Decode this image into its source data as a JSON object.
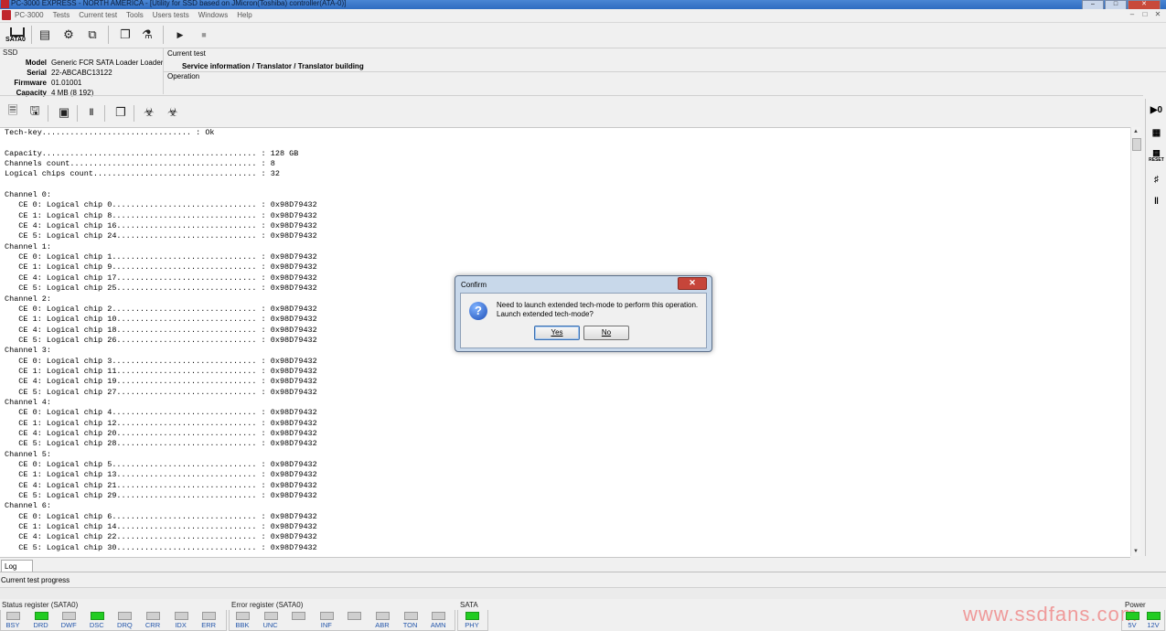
{
  "window": {
    "title": "PC-3000 EXPRESS - NORTH AMERICA - [Utility for SSD based on JMicron(Toshiba) controller(ATA-0)]",
    "controls": [
      "–",
      "□",
      "✕"
    ]
  },
  "menu": {
    "items": [
      "PC-3000",
      "Tests",
      "Current test",
      "Tools",
      "Users tests",
      "Windows",
      "Help"
    ],
    "mdi_controls": [
      "–",
      "□",
      "✕"
    ]
  },
  "toolbar": {
    "sata_label": "SATA0"
  },
  "ssd": {
    "label": "SSD",
    "fields": [
      {
        "key": "Model",
        "value": "Generic FCR SATA Loader Loader"
      },
      {
        "key": "Serial",
        "value": "22-ABCABC13122"
      },
      {
        "key": "Firmware",
        "value": "01.01001"
      },
      {
        "key": "Capacity",
        "value": "4 MB (8 192)"
      }
    ]
  },
  "current_test": {
    "label": "Current test",
    "value": "Service information / Translator / Translator building",
    "operation_label": "Operation"
  },
  "log": {
    "lines": [
      "Tech-key................................ : Ok",
      "",
      "Capacity.............................................. : 128 GB",
      "Channels count........................................ : 8",
      "Logical chips count................................... : 32",
      "",
      "Channel 0:",
      "   CE 0: Logical chip 0............................... : 0x98D79432",
      "   CE 1: Logical chip 8............................... : 0x98D79432",
      "   CE 4: Logical chip 16.............................. : 0x98D79432",
      "   CE 5: Logical chip 24.............................. : 0x98D79432",
      "Channel 1:",
      "   CE 0: Logical chip 1............................... : 0x98D79432",
      "   CE 1: Logical chip 9............................... : 0x98D79432",
      "   CE 4: Logical chip 17.............................. : 0x98D79432",
      "   CE 5: Logical chip 25.............................. : 0x98D79432",
      "Channel 2:",
      "   CE 0: Logical chip 2............................... : 0x98D79432",
      "   CE 1: Logical chip 10.............................. : 0x98D79432",
      "   CE 4: Logical chip 18.............................. : 0x98D79432",
      "   CE 5: Logical chip 26.............................. : 0x98D79432",
      "Channel 3:",
      "   CE 0: Logical chip 3............................... : 0x98D79432",
      "   CE 1: Logical chip 11.............................. : 0x98D79432",
      "   CE 4: Logical chip 19.............................. : 0x98D79432",
      "   CE 5: Logical chip 27.............................. : 0x98D79432",
      "Channel 4:",
      "   CE 0: Logical chip 4............................... : 0x98D79432",
      "   CE 1: Logical chip 12.............................. : 0x98D79432",
      "   CE 4: Logical chip 20.............................. : 0x98D79432",
      "   CE 5: Logical chip 28.............................. : 0x98D79432",
      "Channel 5:",
      "   CE 0: Logical chip 5............................... : 0x98D79432",
      "   CE 1: Logical chip 13.............................. : 0x98D79432",
      "   CE 4: Logical chip 21.............................. : 0x98D79432",
      "   CE 5: Logical chip 29.............................. : 0x98D79432",
      "Channel 6:",
      "   CE 0: Logical chip 6............................... : 0x98D79432",
      "   CE 1: Logical chip 14.............................. : 0x98D79432",
      "   CE 4: Logical chip 22.............................. : 0x98D79432",
      "   CE 5: Logical chip 30.............................. : 0x98D79432"
    ]
  },
  "right_panel": {
    "labels": [
      "RESET"
    ]
  },
  "tabs": {
    "log": "Log"
  },
  "progress": {
    "label": "Current test progress"
  },
  "status_register": {
    "title": "Status register (SATA0)",
    "leds": [
      {
        "name": "BSY",
        "on": false
      },
      {
        "name": "DRD",
        "on": true
      },
      {
        "name": "DWF",
        "on": false
      },
      {
        "name": "DSC",
        "on": true
      },
      {
        "name": "DRQ",
        "on": false
      },
      {
        "name": "CRR",
        "on": false
      },
      {
        "name": "IDX",
        "on": false
      },
      {
        "name": "ERR",
        "on": false
      }
    ]
  },
  "error_register": {
    "title": "Error register (SATA0)",
    "leds": [
      {
        "name": "BBK",
        "on": false
      },
      {
        "name": "UNC",
        "on": false
      },
      {
        "name": "",
        "on": false
      },
      {
        "name": "INF",
        "on": false
      },
      {
        "name": "",
        "on": false
      },
      {
        "name": "ABR",
        "on": false
      },
      {
        "name": "TON",
        "on": false
      },
      {
        "name": "AMN",
        "on": false
      }
    ]
  },
  "sata": {
    "title": "SATA",
    "leds": [
      {
        "name": "PHY",
        "on": true
      }
    ]
  },
  "power": {
    "title": "Power",
    "leds": [
      {
        "name": "5V",
        "on": true
      },
      {
        "name": "12V",
        "on": true
      }
    ]
  },
  "watermark": "www.ssdfans.com",
  "dialog": {
    "title": "Confirm",
    "close": "✕",
    "message_line1": "Need to launch extended tech-mode to perform this operation.",
    "message_line2": "Launch extended tech-mode?",
    "yes": "Yes",
    "no": "No"
  },
  "colors": {
    "led_on": "#22cc22",
    "led_off": "#cfcfcf",
    "register_label": "#2255aa",
    "title_bar": "#2f6cc0",
    "watermark": "#ef9a9a"
  }
}
